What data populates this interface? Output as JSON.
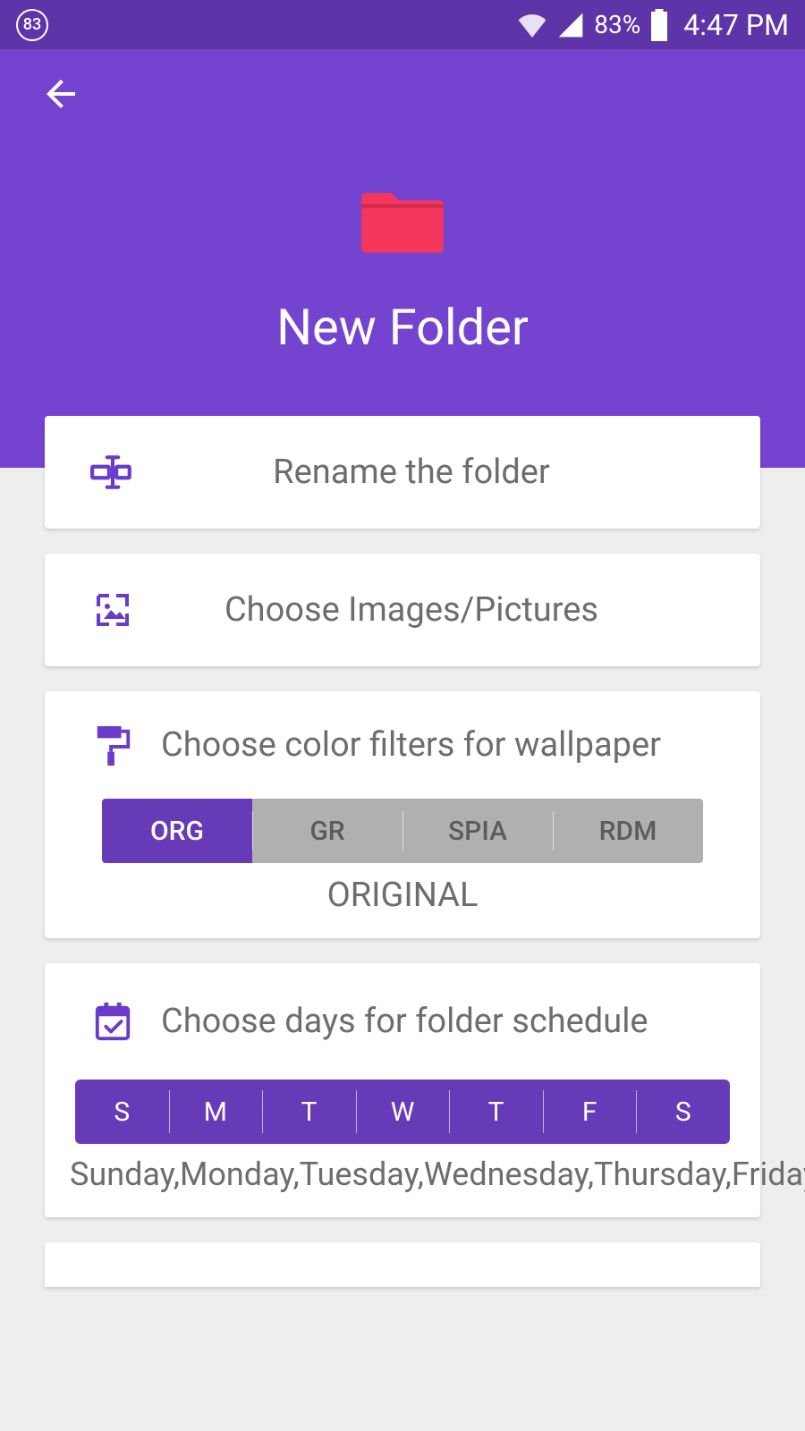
{
  "status": {
    "badge": "83",
    "battery_pct": "83%",
    "time": "4:47 PM"
  },
  "header": {
    "title": "New Folder"
  },
  "rename": {
    "label": "Rename the folder"
  },
  "images": {
    "label": "Choose Images/Pictures"
  },
  "filters": {
    "label": "Choose color filters for wallpaper",
    "options": [
      "ORG",
      "GR",
      "SPIA",
      "RDM"
    ],
    "selected_label": "ORIGINAL",
    "active_index": 0
  },
  "schedule": {
    "label": "Choose days for folder schedule",
    "days": [
      "S",
      "M",
      "T",
      "W",
      "T",
      "F",
      "S"
    ],
    "selected_label": "Sunday,Monday,Tuesday,Wednesday,Thursday,Friday,Saturday"
  }
}
